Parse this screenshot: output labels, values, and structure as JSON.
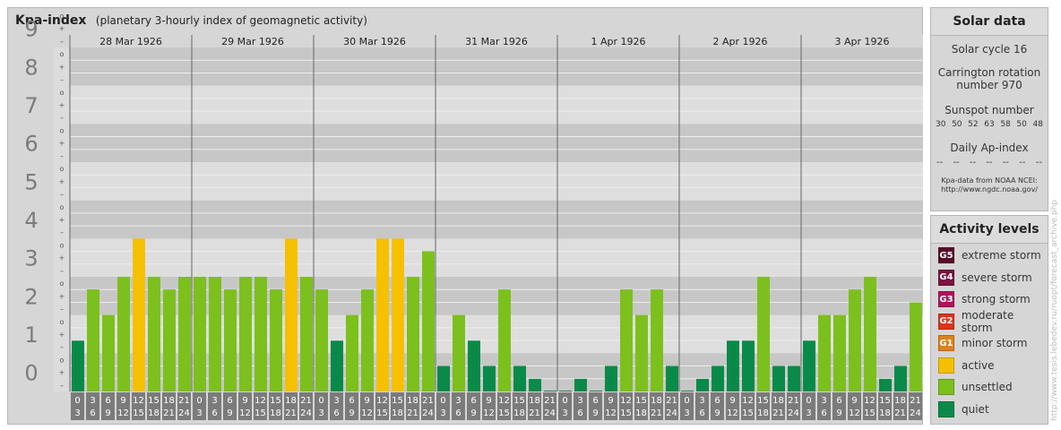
{
  "header": {
    "title": "Kpa-index",
    "subtitle": "(planetary 3-hourly index of geomagnetic activity)"
  },
  "solar": {
    "title": "Solar data",
    "cycle": "Solar cycle 16",
    "carrington_1": "Carrington rotation",
    "carrington_2": "number 970",
    "sunspot_title": "Sunspot number",
    "sunspot_values": [
      "30",
      "50",
      "52",
      "63",
      "58",
      "50",
      "48"
    ],
    "ap_title": "Daily Ap-index",
    "ap_values": [
      "--",
      "--",
      "--",
      "--",
      "--",
      "--",
      "--"
    ],
    "source_1": "Kpa-data from NOAA NCEI:",
    "source_2": "http://www.ngdc.noaa.gov/"
  },
  "levels": {
    "title": "Activity levels",
    "items": [
      {
        "code": "G5",
        "label": "extreme storm",
        "color": "#5a0a2a"
      },
      {
        "code": "G4",
        "label": "severe storm",
        "color": "#7a1340"
      },
      {
        "code": "G3",
        "label": "strong storm",
        "color": "#b0145a"
      },
      {
        "code": "G2",
        "label": "moderate storm",
        "color": "#d8361c"
      },
      {
        "code": "G1",
        "label": "minor storm",
        "color": "#e0801c"
      },
      {
        "code": "",
        "label": "active",
        "color": "#f5c000"
      },
      {
        "code": "",
        "label": "unsettled",
        "color": "#7cc01e"
      },
      {
        "code": "",
        "label": "quiet",
        "color": "#0a8a48"
      }
    ]
  },
  "credit": "http://www.tesis.lebedev.ru/ruopt/forecast_archive.php",
  "colors": {
    "quiet": "#0a8a48",
    "unsettled": "#7cc01e",
    "active": "#f5c000",
    "hour_box": "#7b7b7b"
  },
  "chart_data": {
    "type": "bar",
    "title": "Kpa-index",
    "ylim": [
      0,
      9
    ],
    "y_ticks": [
      "0",
      "1",
      "2",
      "3",
      "4",
      "5",
      "6",
      "7",
      "8",
      "9"
    ],
    "sub_ticks": [
      "o",
      "+",
      "–"
    ],
    "days": [
      "28 Mar 1926",
      "29 Mar 1926",
      "30 Mar 1926",
      "31 Mar 1926",
      "1 Apr 1926",
      "2 Apr 1926",
      "3 Apr 1926"
    ],
    "hours_top": [
      "0",
      "3",
      "6",
      "9",
      "12",
      "15",
      "18",
      "21"
    ],
    "hours_bottom": [
      "3",
      "6",
      "9",
      "12",
      "15",
      "18",
      "21",
      "24"
    ],
    "values": [
      [
        1.33,
        2.67,
        2.0,
        3.0,
        4.0,
        3.0,
        2.67,
        3.0
      ],
      [
        3.0,
        3.0,
        2.67,
        3.0,
        3.0,
        2.67,
        4.0,
        3.0
      ],
      [
        2.67,
        1.33,
        2.0,
        2.67,
        4.0,
        4.0,
        3.0,
        3.67
      ],
      [
        0.67,
        2.0,
        1.33,
        0.67,
        2.67,
        0.67,
        0.33,
        0.0
      ],
      [
        0.0,
        0.33,
        0.0,
        0.67,
        2.67,
        2.0,
        2.67,
        0.67
      ],
      [
        0.0,
        0.33,
        0.67,
        1.33,
        1.33,
        3.0,
        0.67,
        0.67
      ],
      [
        1.33,
        2.0,
        2.0,
        2.67,
        3.0,
        0.33,
        0.67,
        2.33
      ]
    ]
  }
}
